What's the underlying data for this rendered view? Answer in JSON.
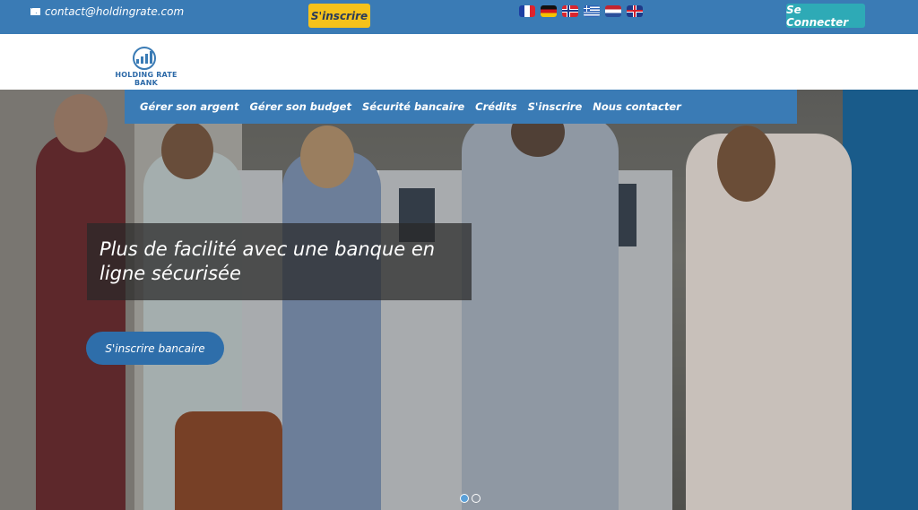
{
  "topbar": {
    "email": "contact@holdingrate.com",
    "signup_label": "S'inscrire",
    "login_label": "Se Connecter",
    "flags": [
      "fr-flag",
      "de-flag",
      "no-flag",
      "gr-flag",
      "nl-flag",
      "gb-flag"
    ]
  },
  "logo": {
    "text": "HOLDING RATE BANK"
  },
  "nav": {
    "items": [
      {
        "label": "Gérer son argent"
      },
      {
        "label": "Gérer son budget"
      },
      {
        "label": "Sécurité bancaire"
      },
      {
        "label": "Crédits"
      },
      {
        "label": "S'inscrire"
      },
      {
        "label": "Nous contacter"
      }
    ]
  },
  "hero": {
    "headline": "Plus de facilité avec une banque en ligne sécurisée",
    "cta_label": "S'inscrire bancaire",
    "slides": 2,
    "active_slide": 1
  },
  "colors": {
    "primary": "#3a7bb5",
    "accent_yellow": "#f5c21b",
    "accent_teal": "#2eaab6",
    "cta": "#2e6eaa"
  }
}
